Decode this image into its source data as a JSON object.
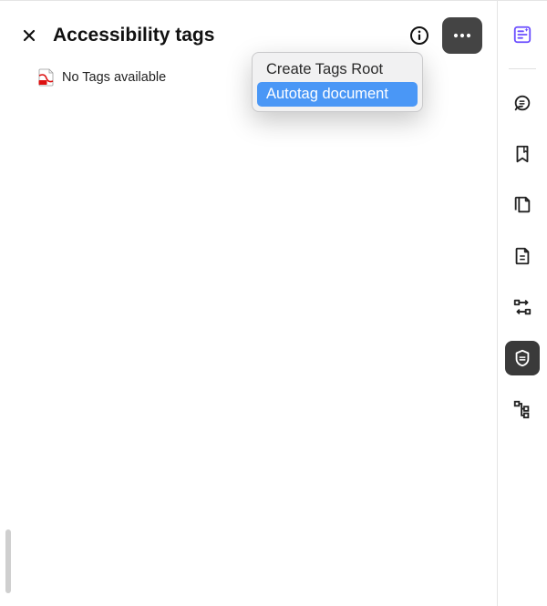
{
  "panel": {
    "title": "Accessibility tags",
    "empty_message": "No Tags available"
  },
  "menu": {
    "items": [
      {
        "label": "Create Tags Root",
        "highlight": false
      },
      {
        "label": "Autotag document",
        "highlight": true
      }
    ]
  },
  "rail": {
    "icons": [
      {
        "name": "ai-sparkle-panel-icon",
        "purple": true,
        "active": false
      },
      {
        "divider": true
      },
      {
        "name": "comment-search-icon",
        "purple": false,
        "active": false
      },
      {
        "name": "bookmark-icon",
        "purple": false,
        "active": false
      },
      {
        "name": "pages-icon",
        "purple": false,
        "active": false
      },
      {
        "name": "document-icon",
        "purple": false,
        "active": false
      },
      {
        "name": "reading-order-icon",
        "purple": false,
        "active": false
      },
      {
        "name": "accessibility-tags-icon",
        "purple": false,
        "active": true
      },
      {
        "name": "structure-tree-icon",
        "purple": false,
        "active": false
      }
    ]
  }
}
